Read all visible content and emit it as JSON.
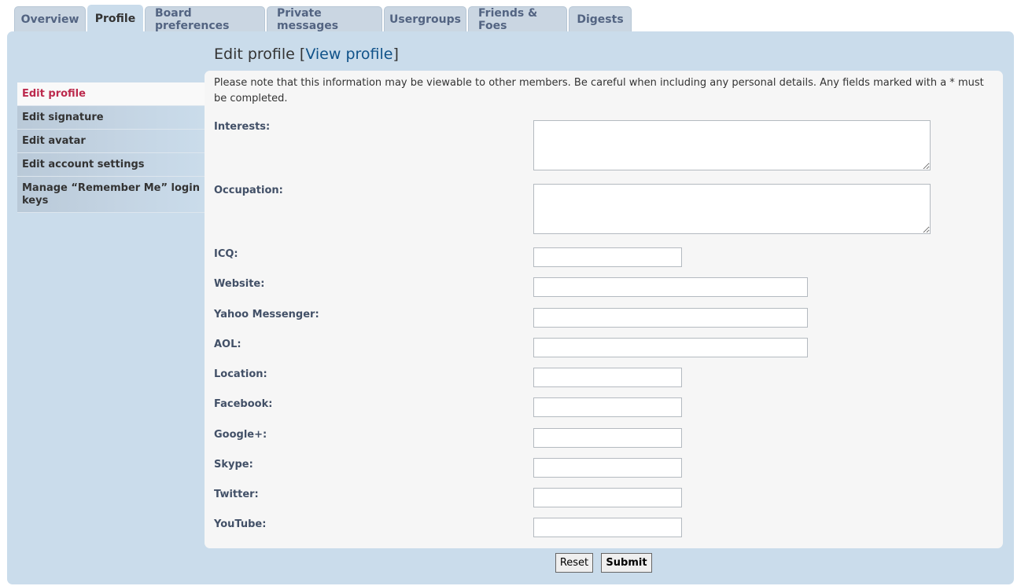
{
  "tabs": [
    {
      "label": "Overview"
    },
    {
      "label": "Profile"
    },
    {
      "label": "Board preferences"
    },
    {
      "label": "Private messages"
    },
    {
      "label": "Usergroups"
    },
    {
      "label": "Friends & Foes"
    },
    {
      "label": "Digests"
    }
  ],
  "active_tab": "Profile",
  "heading": {
    "title": "Edit profile",
    "bracket_open": "[",
    "view_profile_link": "View profile",
    "bracket_close": "]"
  },
  "menu": [
    {
      "label": "Edit profile",
      "active": true
    },
    {
      "label": "Edit signature"
    },
    {
      "label": "Edit avatar"
    },
    {
      "label": "Edit account settings"
    },
    {
      "label": "Manage “Remember Me” login keys"
    }
  ],
  "form": {
    "note": "Please note that this information may be viewable to other members. Be careful when including any personal details. Any fields marked with a * must be completed.",
    "fields": {
      "interests": {
        "label": "Interests:",
        "value": ""
      },
      "occupation": {
        "label": "Occupation:",
        "value": ""
      },
      "icq": {
        "label": "ICQ:",
        "value": ""
      },
      "website": {
        "label": "Website:",
        "value": ""
      },
      "yahoo": {
        "label": "Yahoo Messenger:",
        "value": ""
      },
      "aol": {
        "label": "AOL:",
        "value": ""
      },
      "location": {
        "label": "Location:",
        "value": ""
      },
      "facebook": {
        "label": "Facebook:",
        "value": ""
      },
      "googleplus": {
        "label": "Google+:",
        "value": ""
      },
      "skype": {
        "label": "Skype:",
        "value": ""
      },
      "twitter": {
        "label": "Twitter:",
        "value": ""
      },
      "youtube": {
        "label": "YouTube:",
        "value": ""
      }
    }
  },
  "buttons": {
    "reset": "Reset",
    "submit": "Submit"
  }
}
